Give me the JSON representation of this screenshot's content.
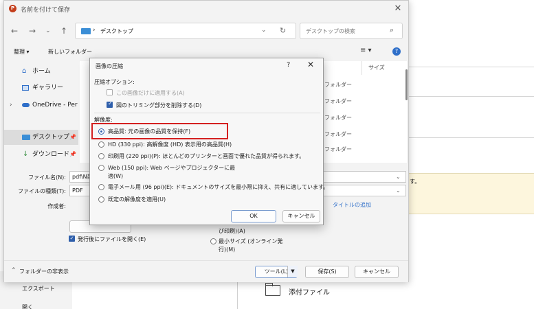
{
  "save_dialog": {
    "title": "名前を付けて保存",
    "address": "デスクトップ",
    "search_placeholder": "デスクトップの検索",
    "toolbar": {
      "organize": "整理 ▾",
      "new_folder": "新しいフォルダー"
    },
    "size_header": "サイズ",
    "sidebar": [
      {
        "label": "ホーム",
        "icon": "home-icon"
      },
      {
        "label": "ギャラリー",
        "icon": "gallery-icon"
      },
      {
        "label": "OneDrive - Perso",
        "icon": "cloud-icon"
      },
      {
        "label": "デスクトップ",
        "icon": "desktop-icon"
      },
      {
        "label": "ダウンロード",
        "icon": "download-icon"
      }
    ],
    "file_rows": [
      "フォルダー",
      "フォルダー",
      "フォルダー",
      "フォルダー",
      "フォルダー"
    ],
    "form": {
      "filename_label": "ファイル名(N):",
      "filename_value": "pdf\\N美",
      "filetype_label": "ファイルの種類(T):",
      "filetype_value": "PDF",
      "author_label": "作成者:",
      "title_add": "タイトルの追加",
      "open_after_save": "発行後にファイルを開く(E)",
      "option_print": "び印刷)(A)",
      "option_min_size_1": "最小サイズ (オンライン発",
      "option_min_size_2": "行)(M)"
    },
    "hide_folders": "フォルダーの非表示",
    "tools_button": "ツール(L)",
    "save_button": "保存(S)",
    "cancel_button": "キャンセル"
  },
  "background": {
    "right_fragment": "す。",
    "export_label": "エクスポート",
    "attachment_label": "添付ファイル"
  },
  "compress_dialog": {
    "title": "画像の圧縮",
    "help": "?",
    "close": "✕",
    "options_header": "圧縮オプション:",
    "apply_only_this": "この画像だけに適用する(A)",
    "delete_cropped": "図のトリミング部分を削除する(D)",
    "resolution_header": "解像度:",
    "resolutions": [
      {
        "label": "高品質: 元の画像の品質を保持(F)",
        "selected": true
      },
      {
        "label": "HD (330 ppi): 高解像度 (HD) 表示用の高品質(H)",
        "selected": false
      },
      {
        "label": "印刷用 (220 ppi)(P): ほとんどのプリンターと画面で優れた品質が得られます。",
        "selected": false
      },
      {
        "label": "Web (150 ppi): Web ページやプロジェクターに最",
        "label2": "適(W)",
        "selected": false
      },
      {
        "label": "電子メール用 (96 ppi)(E): ドキュメントのサイズを最小限に抑え、共有に適しています。",
        "selected": false
      },
      {
        "label": "既定の解像度を適用(U)",
        "selected": false
      }
    ],
    "ok_button": "OK",
    "cancel_button": "キャンセル"
  }
}
